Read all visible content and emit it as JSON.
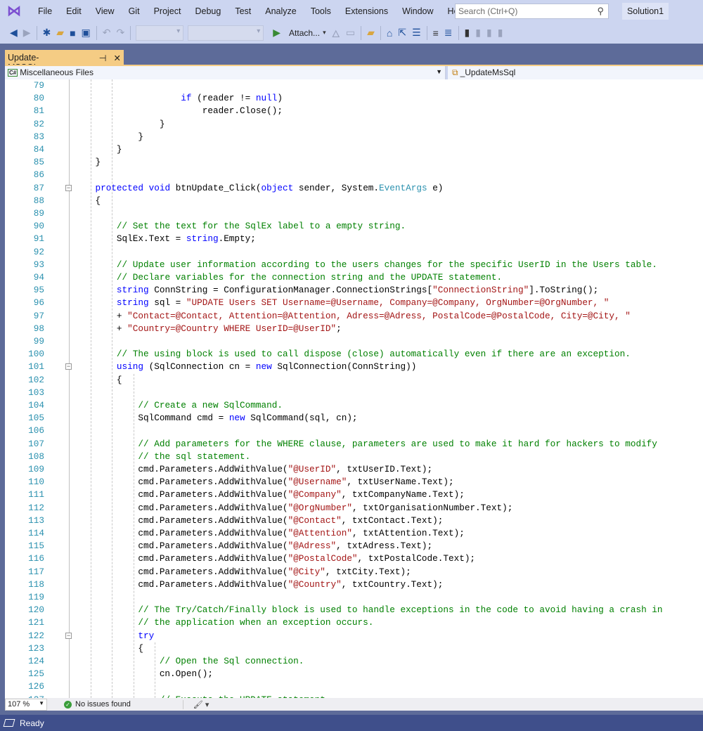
{
  "menu": [
    "File",
    "Edit",
    "View",
    "Git",
    "Project",
    "Debug",
    "Test",
    "Analyze",
    "Tools",
    "Extensions",
    "Window",
    "Help"
  ],
  "search": {
    "placeholder": "Search (Ctrl+Q)",
    "icon": "search-icon"
  },
  "solution": "Solution1",
  "toolbar": {
    "attach_label": "Attach..."
  },
  "tab": {
    "title": "Update-MSSQL.aspx.cs",
    "pin": "⊣",
    "close": "✕"
  },
  "nav": {
    "project": "Miscellaneous Files",
    "project_badge": "C#",
    "member": "_UpdateMsSql"
  },
  "editor": {
    "first_line": 79,
    "fold_lines": [
      87,
      101,
      122
    ],
    "lines": [
      [],
      [
        [
          "p",
          "                    "
        ],
        [
          "k",
          "if"
        ],
        [
          "p",
          " (reader != "
        ],
        [
          "k",
          "null"
        ],
        [
          "p",
          ")"
        ]
      ],
      [
        [
          "p",
          "                        reader.Close();"
        ]
      ],
      [
        [
          "p",
          "                }"
        ]
      ],
      [
        [
          "p",
          "            }"
        ]
      ],
      [
        [
          "p",
          "        }"
        ]
      ],
      [
        [
          "p",
          "    }"
        ]
      ],
      [],
      [
        [
          "p",
          "    "
        ],
        [
          "k",
          "protected"
        ],
        [
          "p",
          " "
        ],
        [
          "k",
          "void"
        ],
        [
          "p",
          " btnUpdate_Click("
        ],
        [
          "k",
          "object"
        ],
        [
          "p",
          " sender, System."
        ],
        [
          "t",
          "EventArgs"
        ],
        [
          "p",
          " e)"
        ]
      ],
      [
        [
          "p",
          "    {"
        ]
      ],
      [],
      [
        [
          "p",
          "        "
        ],
        [
          "c",
          "// Set the text for the SqlEx label to a empty string."
        ]
      ],
      [
        [
          "p",
          "        SqlEx.Text = "
        ],
        [
          "k",
          "string"
        ],
        [
          "p",
          ".Empty;"
        ]
      ],
      [],
      [
        [
          "p",
          "        "
        ],
        [
          "c",
          "// Update user information according to the users changes for the specific UserID in the Users table."
        ]
      ],
      [
        [
          "p",
          "        "
        ],
        [
          "c",
          "// Declare variables for the connection string and the UPDATE statement."
        ]
      ],
      [
        [
          "p",
          "        "
        ],
        [
          "k",
          "string"
        ],
        [
          "p",
          " ConnString = ConfigurationManager.ConnectionStrings["
        ],
        [
          "s",
          "\"ConnectionString\""
        ],
        [
          "p",
          "].ToString();"
        ]
      ],
      [
        [
          "p",
          "        "
        ],
        [
          "k",
          "string"
        ],
        [
          "p",
          " sql = "
        ],
        [
          "s",
          "\"UPDATE Users SET Username=@Username, Company=@Company, OrgNumber=@OrgNumber, \""
        ]
      ],
      [
        [
          "p",
          "        + "
        ],
        [
          "s",
          "\"Contact=@Contact, Attention=@Attention, Adress=@Adress, PostalCode=@PostalCode, City=@City, \""
        ]
      ],
      [
        [
          "p",
          "        + "
        ],
        [
          "s",
          "\"Country=@Country WHERE UserID=@UserID\""
        ],
        [
          "p",
          ";"
        ]
      ],
      [],
      [
        [
          "p",
          "        "
        ],
        [
          "c",
          "// The using block is used to call dispose (close) automatically even if there are an exception."
        ]
      ],
      [
        [
          "p",
          "        "
        ],
        [
          "k",
          "using"
        ],
        [
          "p",
          " (SqlConnection cn = "
        ],
        [
          "k",
          "new"
        ],
        [
          "p",
          " SqlConnection(ConnString))"
        ]
      ],
      [
        [
          "p",
          "        {"
        ]
      ],
      [],
      [
        [
          "p",
          "            "
        ],
        [
          "c",
          "// Create a new SqlCommand."
        ]
      ],
      [
        [
          "p",
          "            SqlCommand cmd = "
        ],
        [
          "k",
          "new"
        ],
        [
          "p",
          " SqlCommand(sql, cn);"
        ]
      ],
      [],
      [
        [
          "p",
          "            "
        ],
        [
          "c",
          "// Add parameters for the WHERE clause, parameters are used to make it hard for hackers to modify"
        ]
      ],
      [
        [
          "p",
          "            "
        ],
        [
          "c",
          "// the sql statement."
        ]
      ],
      [
        [
          "p",
          "            cmd.Parameters.AddWithValue("
        ],
        [
          "s",
          "\"@UserID\""
        ],
        [
          "p",
          ", txtUserID.Text);"
        ]
      ],
      [
        [
          "p",
          "            cmd.Parameters.AddWithValue("
        ],
        [
          "s",
          "\"@Username\""
        ],
        [
          "p",
          ", txtUserName.Text);"
        ]
      ],
      [
        [
          "p",
          "            cmd.Parameters.AddWithValue("
        ],
        [
          "s",
          "\"@Company\""
        ],
        [
          "p",
          ", txtCompanyName.Text);"
        ]
      ],
      [
        [
          "p",
          "            cmd.Parameters.AddWithValue("
        ],
        [
          "s",
          "\"@OrgNumber\""
        ],
        [
          "p",
          ", txtOrganisationNumber.Text);"
        ]
      ],
      [
        [
          "p",
          "            cmd.Parameters.AddWithValue("
        ],
        [
          "s",
          "\"@Contact\""
        ],
        [
          "p",
          ", txtContact.Text);"
        ]
      ],
      [
        [
          "p",
          "            cmd.Parameters.AddWithValue("
        ],
        [
          "s",
          "\"@Attention\""
        ],
        [
          "p",
          ", txtAttention.Text);"
        ]
      ],
      [
        [
          "p",
          "            cmd.Parameters.AddWithValue("
        ],
        [
          "s",
          "\"@Adress\""
        ],
        [
          "p",
          ", txtAdress.Text);"
        ]
      ],
      [
        [
          "p",
          "            cmd.Parameters.AddWithValue("
        ],
        [
          "s",
          "\"@PostalCode\""
        ],
        [
          "p",
          ", txtPostalCode.Text);"
        ]
      ],
      [
        [
          "p",
          "            cmd.Parameters.AddWithValue("
        ],
        [
          "s",
          "\"@City\""
        ],
        [
          "p",
          ", txtCity.Text);"
        ]
      ],
      [
        [
          "p",
          "            cmd.Parameters.AddWithValue("
        ],
        [
          "s",
          "\"@Country\""
        ],
        [
          "p",
          ", txtCountry.Text);"
        ]
      ],
      [],
      [
        [
          "p",
          "            "
        ],
        [
          "c",
          "// The Try/Catch/Finally block is used to handle exceptions in the code to avoid having a crash in"
        ]
      ],
      [
        [
          "p",
          "            "
        ],
        [
          "c",
          "// the application when an exception occurs."
        ]
      ],
      [
        [
          "p",
          "            "
        ],
        [
          "k",
          "try"
        ]
      ],
      [
        [
          "p",
          "            {"
        ]
      ],
      [
        [
          "p",
          "                "
        ],
        [
          "c",
          "// Open the Sql connection."
        ]
      ],
      [
        [
          "p",
          "                cn.Open();"
        ]
      ],
      [],
      [
        [
          "p",
          "                "
        ],
        [
          "c",
          "// Execute the UPDATE statement."
        ]
      ]
    ]
  },
  "bottom": {
    "zoom": "107 %",
    "issues": "No issues found"
  },
  "status": {
    "text": "Ready"
  },
  "colors": {
    "keyword": "#0000ff",
    "type": "#2b91af",
    "string": "#a31515",
    "comment": "#008000",
    "tab": "#f5cc84",
    "statusbar": "#3f4f8b",
    "chrome": "#ccd5f0"
  }
}
